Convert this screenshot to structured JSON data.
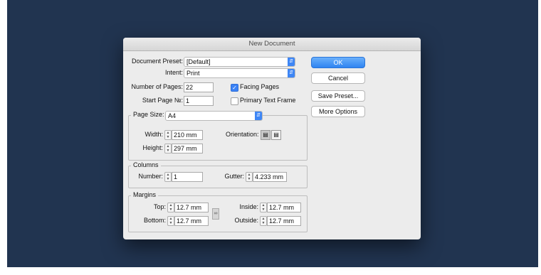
{
  "dialog": {
    "title": "New Document"
  },
  "preset": {
    "label": "Document Preset:",
    "value": "[Default]"
  },
  "intent": {
    "label": "Intent:",
    "value": "Print"
  },
  "pages": {
    "label": "Number of Pages:",
    "value": "22"
  },
  "start_page": {
    "label": "Start Page №:",
    "value": "1"
  },
  "facing_pages": {
    "label": "Facing Pages",
    "checked": true
  },
  "primary_text_frame": {
    "label": "Primary Text Frame",
    "checked": false
  },
  "page_size": {
    "label": "Page Size:",
    "value": "A4",
    "width_label": "Width:",
    "width": "210 mm",
    "height_label": "Height:",
    "height": "297 mm",
    "orientation_label": "Orientation:",
    "orientation": "portrait"
  },
  "columns": {
    "legend": "Columns",
    "number_label": "Number:",
    "number": "1",
    "gutter_label": "Gutter:",
    "gutter": "4.233 mm"
  },
  "margins": {
    "legend": "Margins",
    "top_label": "Top:",
    "top": "12.7 mm",
    "bottom_label": "Bottom:",
    "bottom": "12.7 mm",
    "inside_label": "Inside:",
    "inside": "12.7 mm",
    "outside_label": "Outside:",
    "outside": "12.7 mm"
  },
  "buttons": {
    "ok": "OK",
    "cancel": "Cancel",
    "save_preset": "Save Preset...",
    "more_options": "More Options"
  },
  "colors": {
    "desktop": "#213450",
    "accent": "#3b82f5"
  }
}
